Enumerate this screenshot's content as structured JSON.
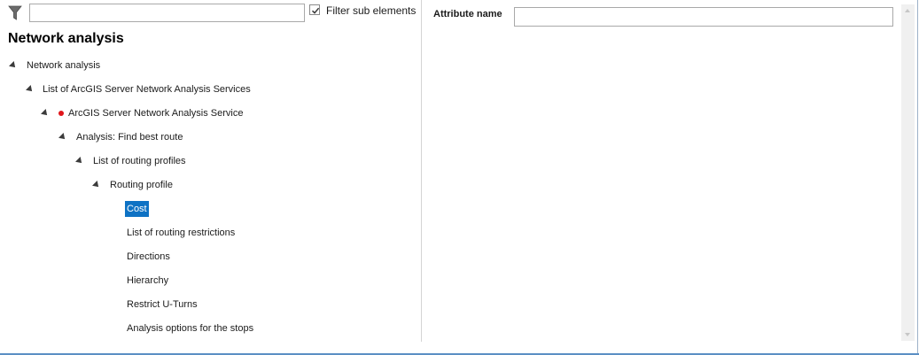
{
  "toolbar": {
    "filter_icon": "funnel-filter-icon",
    "filter_value": "",
    "filter_sub_elements_label": "Filter sub elements",
    "filter_sub_elements_checked": true
  },
  "tree": {
    "title": "Network analysis",
    "nodes": [
      {
        "label": "Network analysis",
        "expanded": true,
        "status": null
      },
      {
        "label": "List of ArcGIS Server Network Analysis Services",
        "expanded": true,
        "status": null
      },
      {
        "label": "ArcGIS Server Network Analysis Service",
        "expanded": true,
        "status": "error-red-dot"
      },
      {
        "label": "Analysis: Find best route",
        "expanded": true,
        "status": null
      },
      {
        "label": "List of routing profiles",
        "expanded": true,
        "status": null
      },
      {
        "label": "Routing profile",
        "expanded": true,
        "status": null
      },
      {
        "label": "Cost",
        "selected": true
      },
      {
        "label": "List of routing restrictions"
      },
      {
        "label": "Directions"
      },
      {
        "label": "Hierarchy"
      },
      {
        "label": "Restrict U-Turns"
      },
      {
        "label": "Analysis options for the stops"
      }
    ]
  },
  "details": {
    "attribute_name_label": "Attribute name",
    "attribute_name_value": ""
  },
  "colors": {
    "selection": "#0e72c4",
    "status_dot": "#e0161b",
    "accent_border": "#5b8fc4"
  }
}
